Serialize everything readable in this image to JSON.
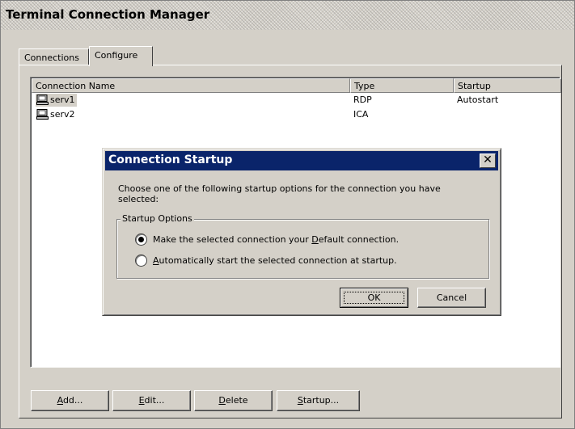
{
  "window": {
    "title": "Terminal Connection Manager"
  },
  "tabs": [
    {
      "label": "Connections",
      "active": false
    },
    {
      "label": "Configure",
      "active": true
    }
  ],
  "list": {
    "columns": [
      "Connection Name",
      "Type",
      "Startup"
    ],
    "rows": [
      {
        "name": "serv1",
        "type": "RDP",
        "startup": "Autostart",
        "selected": true,
        "icon": "computer-icon"
      },
      {
        "name": "serv2",
        "type": "ICA",
        "startup": "",
        "selected": false,
        "icon": "computer-icon"
      }
    ]
  },
  "buttons": {
    "add": {
      "u": "A",
      "rest": "dd..."
    },
    "edit": {
      "u": "E",
      "rest": "dit..."
    },
    "delete": {
      "u": "D",
      "rest": "elete"
    },
    "startup": {
      "u": "S",
      "rest": "tartup..."
    }
  },
  "dialog": {
    "title": "Connection Startup",
    "close_icon": "close-icon",
    "description": "Choose one of the following startup options for the connection you have selected:",
    "group_label": "Startup Options",
    "options": [
      {
        "pre": "Make the selected connection your ",
        "u": "D",
        "post": "efault connection.",
        "checked": true
      },
      {
        "pre": "",
        "u": "A",
        "post": "utomatically start the selected connection at startup.",
        "checked": false
      }
    ],
    "ok_label": "OK",
    "cancel_label": "Cancel"
  },
  "colors": {
    "face": "#d4d0c8",
    "dialog_title": "#0a246a"
  }
}
